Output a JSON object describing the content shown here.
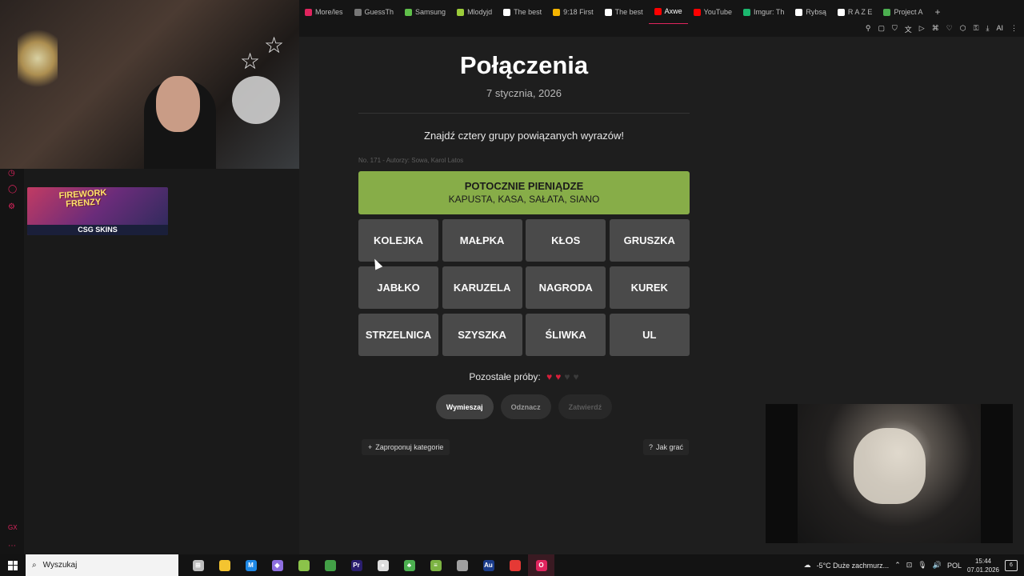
{
  "browser": {
    "tabs": [
      {
        "label": "More/les",
        "color": "#e0245e"
      },
      {
        "label": "GuessTh",
        "color": "#777777"
      },
      {
        "label": "Samsung",
        "color": "#5fbf4a"
      },
      {
        "label": "Mlodyjd",
        "color": "#9ccc3a"
      },
      {
        "label": "The best",
        "color": "#ffffff"
      },
      {
        "label": "9:18 First",
        "color": "#f4b400"
      },
      {
        "label": "The best",
        "color": "#ffffff"
      },
      {
        "label": "Axwe",
        "color": "#ff0000"
      },
      {
        "label": "YouTube",
        "color": "#ff0000"
      },
      {
        "label": "Imgur: Th",
        "color": "#1bb76e"
      },
      {
        "label": "Rybsą",
        "color": "#ffffff"
      },
      {
        "label": "R A Z E",
        "color": "#ffffff"
      },
      {
        "label": "Project A",
        "color": "#4caf50"
      }
    ],
    "active_tab_index": 7,
    "new_tab": "+",
    "toolbar_ai": "AI"
  },
  "sidebar": {
    "icons": [
      "clock-icon",
      "chat-icon",
      "settings-icon"
    ],
    "bottom_label": "GX"
  },
  "ad": {
    "title_line1": "FIREWORK",
    "title_line2": "FRENZY",
    "brand": "CSG SKINS"
  },
  "game": {
    "title": "Połączenia",
    "date": "7 stycznia, 2026",
    "subtitle": "Znajdź cztery grupy powiązanych wyrazów!",
    "meta": "No. 171 - Autorzy: Sowa, Karol Latos",
    "solved_groups": [
      {
        "name": "POTOCZNIE PIENIĄDZE",
        "words": "KAPUSTA, KASA, SAŁATA, SIANO",
        "color": "#87ad48"
      }
    ],
    "tiles": [
      "KOLEJKA",
      "MAŁPKA",
      "KŁOS",
      "GRUSZKA",
      "JABŁKO",
      "KARUZELA",
      "NAGRODA",
      "KUREK",
      "STRZELNICA",
      "SZYSZKA",
      "ŚLIWKA",
      "UL"
    ],
    "tries_label": "Pozostałe próby:",
    "tries_remaining": 2,
    "tries_total": 4,
    "buttons": {
      "shuffle": "Wymieszaj",
      "deselect": "Odznacz",
      "submit": "Zatwierdź"
    },
    "suggest_category": "Zaproponuj kategorie",
    "how_to_play": "Jak grać"
  },
  "taskbar": {
    "search_placeholder": "Wyszukaj",
    "apps": [
      {
        "name": "task-view",
        "glyph": "⊞",
        "color": "#bdbdbd"
      },
      {
        "name": "file-explorer",
        "glyph": "",
        "color": "#f4c430"
      },
      {
        "name": "app-m",
        "glyph": "M",
        "color": "#1e88e5"
      },
      {
        "name": "app-crystal",
        "glyph": "◆",
        "color": "#8e6fe0"
      },
      {
        "name": "app-game",
        "glyph": "",
        "color": "#8bc34a"
      },
      {
        "name": "app-sheet",
        "glyph": "",
        "color": "#43a047"
      },
      {
        "name": "premiere",
        "glyph": "Pr",
        "color": "#2a1e6e"
      },
      {
        "name": "steam",
        "glyph": "●",
        "color": "#dddddd"
      },
      {
        "name": "app-green",
        "glyph": "♣",
        "color": "#4caf50"
      },
      {
        "name": "app-stack",
        "glyph": "≡",
        "color": "#7cb342"
      },
      {
        "name": "app-feather",
        "glyph": "",
        "color": "#a0a0a0"
      },
      {
        "name": "audition",
        "glyph": "Au",
        "color": "#1b3c8a"
      },
      {
        "name": "app-circle",
        "glyph": "",
        "color": "#e53935"
      },
      {
        "name": "opera-gx",
        "glyph": "O",
        "color": "#e0245e"
      }
    ],
    "weather": "-5°C  Duże zachmurz...",
    "language": "POL",
    "time": "15:44",
    "date": "07.01.2026",
    "notifications": "6"
  }
}
